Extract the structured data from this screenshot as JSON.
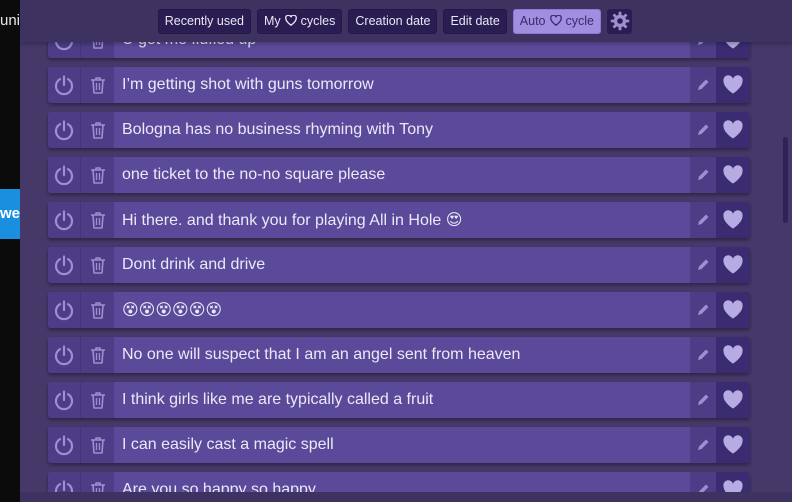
{
  "background": {
    "partial_text_top": "uni",
    "partial_text_blue": "we"
  },
  "toolbar": {
    "buttons": [
      {
        "label": "Recently used",
        "active": false,
        "heart": false
      },
      {
        "label_before": "My",
        "label_after": "cycles",
        "active": false,
        "heart": true
      },
      {
        "label": "Creation date",
        "active": false,
        "heart": false
      },
      {
        "label": "Edit date",
        "active": false,
        "heart": false
      },
      {
        "label_before": "Auto",
        "label_after": "cycle",
        "active": true,
        "heart": true
      }
    ],
    "settings_icon": "gear-icon"
  },
  "phrases": [
    {
      "text": "U got me flufled up",
      "partial": true
    },
    {
      "text": "I’m getting shot with guns tomorrow"
    },
    {
      "text": "Bologna has no business rhyming with Tony"
    },
    {
      "text": "one ticket to the no-no square please"
    },
    {
      "text": "Hi there. and thank you for playing All in Hole 😍"
    },
    {
      "text": "Dont drink and drive"
    },
    {
      "text": "😵😵😵😵😵😵"
    },
    {
      "text": "No one will suspect that I am an angel sent from heaven"
    },
    {
      "text": "I think girls like me are typically called a fruit"
    },
    {
      "text": "I can easily cast a magic spell"
    },
    {
      "text": "Are you so happy so happy",
      "partial": true
    }
  ],
  "icons": {
    "power": "power-icon",
    "delete": "trash-icon",
    "edit": "pencil-icon",
    "favorite": "heart-icon"
  },
  "colors": {
    "panel": "#463869",
    "row": "#5b4a9a",
    "active_button": "#a18ee0",
    "button": "#2a1d52"
  }
}
